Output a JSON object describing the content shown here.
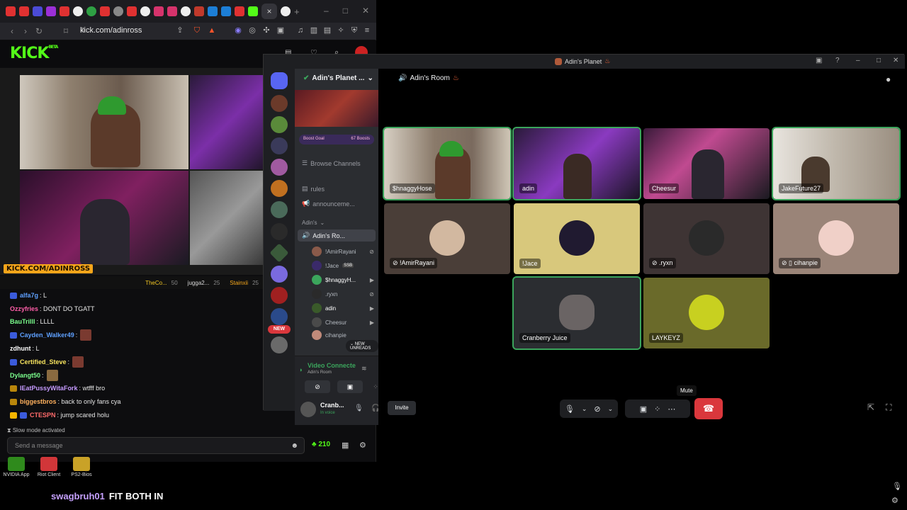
{
  "browser": {
    "url": "kick.com/adinross",
    "tab_close": "×",
    "new_tab": "+",
    "window_controls": [
      "–",
      "□",
      "✕"
    ]
  },
  "kick": {
    "logo": "KICK",
    "logo_beta": "BETA",
    "stream_url_badge": "KICK.COM/ADINROSS",
    "pinned": [
      {
        "name": "TheCo...",
        "count": "50"
      },
      {
        "name": "jugga2...",
        "count": "25"
      },
      {
        "name": "Stainxii",
        "count": "25"
      }
    ],
    "chat": [
      {
        "user": "alfa7g",
        "text": ": L",
        "color": "#5ea0ff"
      },
      {
        "user": "Ozzyfries",
        "text": ": DONT DO TGATT",
        "color": "#ff5ea8"
      },
      {
        "user": "BauTrilll",
        "text": ": LLLL",
        "color": "#7bff8d"
      },
      {
        "user": "Cayden_Walker49",
        "text": ":",
        "color": "#5ea0ff"
      },
      {
        "user": "zdhunt",
        "text": ": L",
        "color": "#ffffff"
      },
      {
        "user": "Certified_Steve",
        "text": ":",
        "color": "#f7e35e"
      },
      {
        "user": "Dylangt50",
        "text": ":",
        "color": "#7bff8d"
      },
      {
        "user": "IEatPussyWitaFork",
        "text": ": wtfff bro",
        "color": "#c69bff"
      },
      {
        "user": "biggestbros",
        "text": ": back to only fans cya",
        "color": "#ffb15e"
      },
      {
        "user": "CTESPN",
        "text": ": jump scared holu",
        "color": "#ff6b6b"
      }
    ],
    "slow_mode": "Slow mode activated",
    "input_placeholder": "Send a message",
    "kick_count": "210"
  },
  "desktop": {
    "icons": [
      "NVIDIA App",
      "Riot Client",
      "PS2-Bios"
    ]
  },
  "overlay_chat": {
    "user": "swagbruh01",
    "text": "FIT BOTH IN"
  },
  "discord": {
    "window_title": "Adin's Planet",
    "server_name": "Adin's Planet ...",
    "boost_goal": "Boost Goal",
    "boost_count": "67 Boosts",
    "browse_channels": "Browse Channels",
    "channels": [
      "rules",
      "announceme..."
    ],
    "category": "Adin's",
    "voice_channel": "Adin's Ro...",
    "voice_users": [
      "!AmirRayani",
      "!Jace",
      "$hnaggyH...",
      ".ryxn",
      "adin",
      "Cheesur",
      "cihanpie"
    ],
    "ssb_tag": "SSB",
    "new_badge": "NEW",
    "new_unreads": "NEW UNREADS",
    "video_connected": "Video Connecte",
    "video_connected_sub": "Adin's Room",
    "user_name": "Cranb...",
    "user_status": "In voice",
    "room_title": "Adin's Room",
    "tiles": [
      {
        "name": "$hnaggyHose",
        "speaking": true
      },
      {
        "name": "adin",
        "speaking": true
      },
      {
        "name": "Cheesur",
        "speaking": false
      },
      {
        "name": "JakeFuture27",
        "speaking": true
      },
      {
        "name": "!AmirRayani",
        "speaking": false
      },
      {
        "name": "!Jace",
        "speaking": false
      },
      {
        "name": ".ryxn",
        "speaking": false
      },
      {
        "name": "cihanpie",
        "speaking": false
      },
      {
        "name": "Cranberry Juice",
        "speaking": true
      },
      {
        "name": "LAYKEYZ",
        "speaking": false
      }
    ],
    "mute_tooltip": "Mute",
    "invite": "Invite"
  }
}
